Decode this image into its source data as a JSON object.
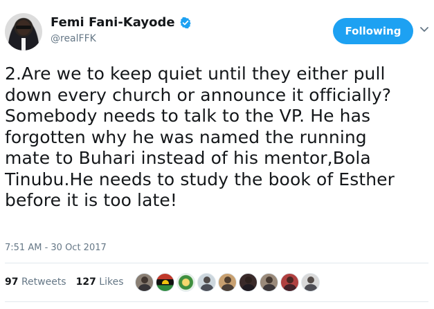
{
  "author": {
    "name": "Femi Fani-Kayode",
    "handle": "@realFFK",
    "verified": true,
    "avatar_icon": "user-avatar"
  },
  "follow_button": {
    "label": "Following"
  },
  "tweet": {
    "text": "2.Are we to keep quiet until they either pull\ndown every church or announce it officially?\nSomebody needs to talk to the VP. He has\nforgotten why he was named the running\nmate to Buhari instead of his mentor,Bola\nTinubu.He needs to study the book of Esther\nbefore it is too late!",
    "timestamp": "7:51 AM - 30 Oct 2017"
  },
  "stats": {
    "retweets_count": "97",
    "retweets_label": "Retweets",
    "likes_count": "127",
    "likes_label": "Likes"
  },
  "likers": [
    {
      "icon": "liker-avatar",
      "color": "#8a7f74"
    },
    {
      "icon": "biafra-flag-avatar",
      "color": "#b22222"
    },
    {
      "icon": "badge-avatar",
      "color": "#3e8e3e"
    },
    {
      "icon": "default-avatar",
      "color": "#aab8c2"
    },
    {
      "icon": "liker-avatar",
      "color": "#c8a070"
    },
    {
      "icon": "liker-avatar",
      "color": "#3a2a2a"
    },
    {
      "icon": "liker-avatar",
      "color": "#9a8a7a"
    },
    {
      "icon": "liker-avatar",
      "color": "#b04040"
    },
    {
      "icon": "liker-avatar",
      "color": "#d8d8d8"
    }
  ],
  "colors": {
    "accent": "#1da1f2",
    "text": "#14171a",
    "muted": "#657786",
    "border": "#e1e8ed"
  }
}
